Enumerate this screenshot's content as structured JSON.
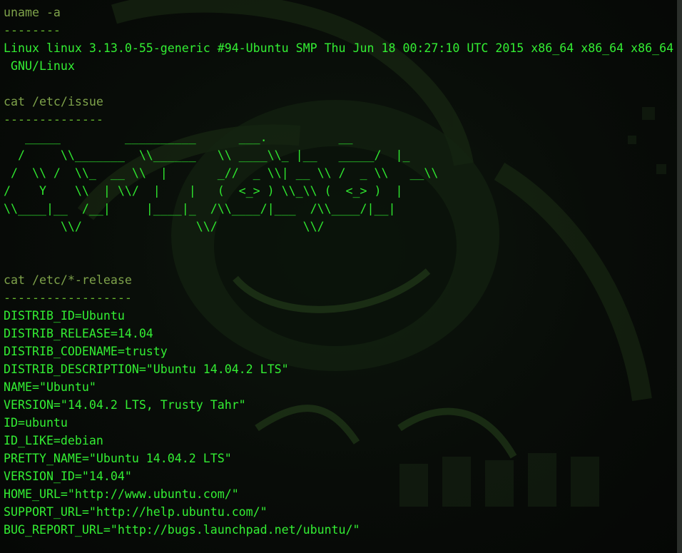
{
  "terminal": {
    "colors": {
      "background": "#070b07",
      "command": "#7ea24a",
      "separator": "#66b52e",
      "output": "#33ee33"
    },
    "lines": [
      {
        "kind": "cmd",
        "text": "uname -a"
      },
      {
        "kind": "sep",
        "text": "--------"
      },
      {
        "kind": "out",
        "text": "Linux linux 3.13.0-55-generic #94-Ubuntu SMP Thu Jun 18 00:27:10 UTC 2015 x86_64 x86_64 x86_64"
      },
      {
        "kind": "out",
        "text": " GNU/Linux"
      },
      {
        "kind": "out",
        "text": ""
      },
      {
        "kind": "cmd",
        "text": "cat /etc/issue"
      },
      {
        "kind": "sep",
        "text": "--------------"
      },
      {
        "kind": "art",
        "text": "   _____         __________      ___.          __"
      },
      {
        "kind": "art",
        "text": "  /     \\\\_______  \\\\______   \\\\ ____\\\\_ |__   _____/  |_"
      },
      {
        "kind": "art",
        "text": " /  \\\\ /  \\\\_  __ \\\\  |       _//  _ \\\\| __ \\\\ /  _ \\\\   __\\\\"
      },
      {
        "kind": "art",
        "text": "/    Y    \\\\  | \\\\/  |    |   (  <_> ) \\\\_\\\\ (  <_> )  |"
      },
      {
        "kind": "art",
        "text": "\\\\____|__  /__|     |____|_  /\\\\____/|___  /\\\\____/|__|"
      },
      {
        "kind": "art",
        "text": "        \\\\/                \\\\/            \\\\/"
      },
      {
        "kind": "out",
        "text": ""
      },
      {
        "kind": "out",
        "text": ""
      },
      {
        "kind": "cmd",
        "text": "cat /etc/*-release"
      },
      {
        "kind": "sep",
        "text": "------------------"
      },
      {
        "kind": "out",
        "text": "DISTRIB_ID=Ubuntu"
      },
      {
        "kind": "out",
        "text": "DISTRIB_RELEASE=14.04"
      },
      {
        "kind": "out",
        "text": "DISTRIB_CODENAME=trusty"
      },
      {
        "kind": "out",
        "text": "DISTRIB_DESCRIPTION=\"Ubuntu 14.04.2 LTS\""
      },
      {
        "kind": "out",
        "text": "NAME=\"Ubuntu\""
      },
      {
        "kind": "out",
        "text": "VERSION=\"14.04.2 LTS, Trusty Tahr\""
      },
      {
        "kind": "out",
        "text": "ID=ubuntu"
      },
      {
        "kind": "out",
        "text": "ID_LIKE=debian"
      },
      {
        "kind": "out",
        "text": "PRETTY_NAME=\"Ubuntu 14.04.2 LTS\""
      },
      {
        "kind": "out",
        "text": "VERSION_ID=\"14.04\""
      },
      {
        "kind": "out",
        "text": "HOME_URL=\"http://www.ubuntu.com/\""
      },
      {
        "kind": "out",
        "text": "SUPPORT_URL=\"http://help.ubuntu.com/\""
      },
      {
        "kind": "out",
        "text": "BUG_REPORT_URL=\"http://bugs.launchpad.net/ubuntu/\""
      }
    ]
  }
}
